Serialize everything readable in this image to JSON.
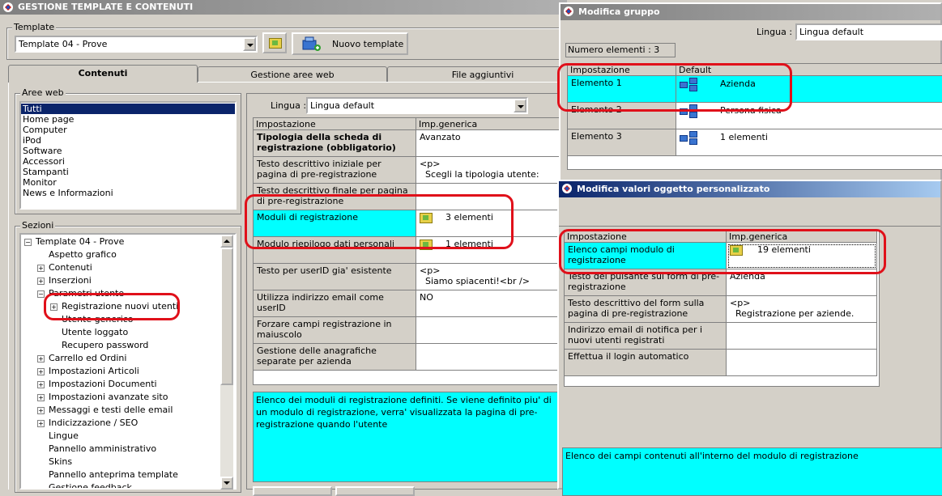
{
  "main_window": {
    "title": "GESTIONE TEMPLATE E CONTENUTI",
    "template_group_label": "Template",
    "template_selected": "Template 04 - Prove",
    "new_template_button": "Nuovo template",
    "tabs": [
      "Contenuti",
      "Gestione aree web",
      "File aggiuntivi"
    ],
    "aree_web_label": "Aree web",
    "aree_web_items": [
      "Tutti",
      "Home page",
      "Computer",
      "iPod",
      "Software",
      "Accessori",
      "Stampanti",
      "Monitor",
      "News e Informazioni"
    ],
    "sezioni_label": "Sezioni",
    "tree": [
      {
        "label": "Template 04 - Prove",
        "level": 0,
        "expander": "minus"
      },
      {
        "label": "Aspetto grafico",
        "level": 1,
        "expander": ""
      },
      {
        "label": "Contenuti",
        "level": 1,
        "expander": "plus"
      },
      {
        "label": "Inserzioni",
        "level": 1,
        "expander": "plus"
      },
      {
        "label": "Parametri utente",
        "level": 1,
        "expander": "minus"
      },
      {
        "label": "Registrazione nuovi utenti",
        "level": 2,
        "expander": "plus"
      },
      {
        "label": "Utente generico",
        "level": 2,
        "expander": ""
      },
      {
        "label": "Utente loggato",
        "level": 2,
        "expander": ""
      },
      {
        "label": "Recupero password",
        "level": 2,
        "expander": ""
      },
      {
        "label": "Carrello ed Ordini",
        "level": 1,
        "expander": "plus"
      },
      {
        "label": "Impostazioni Articoli",
        "level": 1,
        "expander": "plus"
      },
      {
        "label": "Impostazioni Documenti",
        "level": 1,
        "expander": "plus"
      },
      {
        "label": "Impostazioni avanzate sito",
        "level": 1,
        "expander": "plus"
      },
      {
        "label": "Messaggi e testi delle email",
        "level": 1,
        "expander": "plus"
      },
      {
        "label": "Indicizzazione / SEO",
        "level": 1,
        "expander": "plus"
      },
      {
        "label": "Lingue",
        "level": 1,
        "expander": ""
      },
      {
        "label": "Pannello amministrativo",
        "level": 1,
        "expander": ""
      },
      {
        "label": "Skins",
        "level": 1,
        "expander": ""
      },
      {
        "label": "Pannello anteprima template",
        "level": 1,
        "expander": ""
      },
      {
        "label": "Gestione feedback",
        "level": 1,
        "expander": ""
      }
    ],
    "lingua_label": "Lingua :",
    "lingua_value": "Lingua default",
    "grid_headers": [
      "Impostazione",
      "Imp.generica"
    ],
    "grid_rows": [
      {
        "name": "Tipologia della scheda di registrazione (obbligatorio)",
        "value": "Avanzato",
        "bold": true,
        "icon": ""
      },
      {
        "name": "Testo descrittivo iniziale per pagina di pre-registrazione",
        "value": "<p>\n  Scegli la tipologia utente:",
        "bold": false,
        "icon": ""
      },
      {
        "name": "Testo descrittivo finale per pagina di pre-registrazione",
        "value": "",
        "bold": false,
        "icon": ""
      },
      {
        "name": "Moduli di registrazione",
        "value": "3 elementi",
        "bold": false,
        "icon": "folder",
        "highlight": true
      },
      {
        "name": "Modulo riepilogo dati personali",
        "value": "1 elementi",
        "bold": false,
        "icon": "folder"
      },
      {
        "name": "Testo per userID gia' esistente",
        "value": "<p>\n  Siamo spiacenti!<br />",
        "bold": false,
        "icon": ""
      },
      {
        "name": "Utilizza indirizzo email come userID",
        "value": "NO",
        "bold": false,
        "icon": ""
      },
      {
        "name": "Forzare campi registrazione in maiuscolo",
        "value": "",
        "bold": false,
        "icon": ""
      },
      {
        "name": "Gestione delle anagrafiche separate per azienda",
        "value": "",
        "bold": false,
        "icon": ""
      }
    ],
    "description": "Elenco dei moduli di registrazione definiti. Se viene definito piu' di un modulo di registrazione, verra' visualizzata la pagina di pre-registrazione quando l'utente"
  },
  "gruppo_window": {
    "title": "Modifica gruppo",
    "lingua_label": "Lingua :",
    "lingua_value": "Lingua default",
    "count_text": "Numero elementi : 3",
    "headers": [
      "Impostazione",
      "Default"
    ],
    "rows": [
      {
        "name": "Elemento 1",
        "value": "Azienda",
        "highlight": true
      },
      {
        "name": "Elemento 2",
        "value": "Persona fisica",
        "highlight": false
      },
      {
        "name": "Elemento 3",
        "value": "1 elementi",
        "highlight": false
      }
    ]
  },
  "oggetto_window": {
    "title": "Modifica valori oggetto personalizzato",
    "headers": [
      "Impostazione",
      "Imp.generica"
    ],
    "rows": [
      {
        "name": "Elenco campi modulo di registrazione",
        "value": "19 elementi",
        "icon": "folder",
        "highlight": true
      },
      {
        "name": "Testo del pulsante sul form di pre-registrazione",
        "value": "Azienda",
        "icon": ""
      },
      {
        "name": "Testo descrittivo del form sulla pagina di pre-registrazione",
        "value": "<p>\n  Registrazione per aziende.",
        "icon": ""
      },
      {
        "name": "Indirizzo email di notifica per i nuovi utenti registrati",
        "value": "",
        "icon": ""
      },
      {
        "name": "Effettua il login automatico",
        "value": "",
        "icon": ""
      }
    ],
    "description": "Elenco dei campi contenuti all'interno del modulo di registrazione"
  },
  "colors": {
    "highlight": "#00ffff",
    "selection": "#0a246a",
    "annotation": "#e0101a",
    "title_active": "#0a246a"
  }
}
